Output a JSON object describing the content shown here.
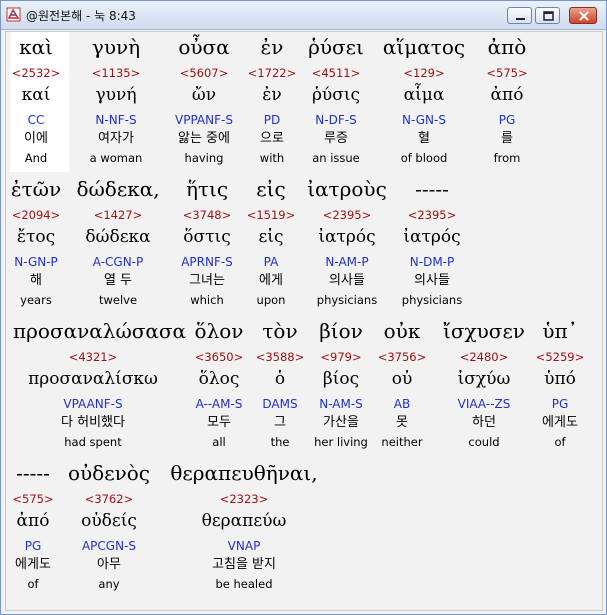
{
  "window": {
    "title": "@원전본해 - 눅 8:43"
  },
  "rows": [
    {
      "words": [
        {
          "greek": "καὶ",
          "strong": "<2532>",
          "lemma": "καί",
          "parse": "CC",
          "korean": "이에",
          "english": "And"
        },
        {
          "greek": "γυνὴ",
          "strong": "<1135>",
          "lemma": "γυνή",
          "parse": "N-NF-S",
          "korean": "여자가",
          "english": "a woman"
        },
        {
          "greek": "οὖσα",
          "strong": "<5607>",
          "lemma": "ὤν",
          "parse": "VPPANF-S",
          "korean": "앓는 중에",
          "english": "having"
        },
        {
          "greek": "ἐν",
          "strong": "<1722>",
          "lemma": "ἐν",
          "parse": "PD",
          "korean": "으로",
          "english": "with"
        },
        {
          "greek": "ῥύσει",
          "strong": "<4511>",
          "lemma": "ῥύσις",
          "parse": "N-DF-S",
          "korean": "루증",
          "english": "an issue"
        },
        {
          "greek": "αἵματος",
          "strong": "<129>",
          "lemma": "αἷμα",
          "parse": "N-GN-S",
          "korean": "혈",
          "english": "of blood"
        },
        {
          "greek": "ἀπὸ",
          "strong": "<575>",
          "lemma": "ἀπό",
          "parse": "PG",
          "korean": "를",
          "english": "from"
        }
      ]
    },
    {
      "words": [
        {
          "greek": "ἐτῶν",
          "strong": "<2094>",
          "lemma": "ἔτος",
          "parse": "N-GN-P",
          "korean": "해",
          "english": "years"
        },
        {
          "greek": "δώδεκα,",
          "strong": "<1427>",
          "lemma": "δώδεκα",
          "parse": "A-CGN-P",
          "korean": "열 두",
          "english": "twelve"
        },
        {
          "greek": "ἥτις",
          "strong": "<3748>",
          "lemma": "ὅστις",
          "parse": "APRNF-S",
          "korean": "그녀는",
          "english": "which"
        },
        {
          "greek": "εἰς",
          "strong": "<1519>",
          "lemma": "εἰς",
          "parse": "PA",
          "korean": "에게",
          "english": "upon"
        },
        {
          "greek": "ἰατροὺς",
          "strong": "<2395>",
          "lemma": "ἰατρός",
          "parse": "N-AM-P",
          "korean": "의사들",
          "english": "physicians"
        },
        {
          "greek": "-----",
          "strong": "<2395>",
          "lemma": "ἰατρός",
          "parse": "N-DM-P",
          "korean": "의사들",
          "english": "physicians"
        }
      ]
    },
    {
      "words": [
        {
          "greek": "προσαναλώσασα",
          "strong": "<4321>",
          "lemma": "προσαναλίσκω",
          "parse": "VPAANF-S",
          "korean": "다 허비했다",
          "english": "had spent"
        },
        {
          "greek": "ὅλον",
          "strong": "<3650>",
          "lemma": "ὅλος",
          "parse": "A--AM-S",
          "korean": "모두",
          "english": "all"
        },
        {
          "greek": "τὸν",
          "strong": "<3588>",
          "lemma": "ὁ",
          "parse": "DAMS",
          "korean": "그",
          "english": "the"
        },
        {
          "greek": "βίον",
          "strong": "<979>",
          "lemma": "βίος",
          "parse": "N-AM-S",
          "korean": "가산을",
          "english": "her living"
        },
        {
          "greek": "οὐκ",
          "strong": "<3756>",
          "lemma": "οὐ",
          "parse": "AB",
          "korean": "못",
          "english": "neither"
        },
        {
          "greek": "ἴσχυσεν",
          "strong": "<2480>",
          "lemma": "ἰσχύω",
          "parse": "VIAA--ZS",
          "korean": "하던",
          "english": "could"
        },
        {
          "greek": "ὑπ᾽",
          "strong": "<5259>",
          "lemma": "ὑπό",
          "parse": "PG",
          "korean": "에게도",
          "english": "of"
        }
      ]
    },
    {
      "words": [
        {
          "greek": "-----",
          "strong": "<575>",
          "lemma": "ἀπό",
          "parse": "PG",
          "korean": "에게도",
          "english": "of"
        },
        {
          "greek": "οὐδενὸς",
          "strong": "<3762>",
          "lemma": "οὐδείς",
          "parse": "APCGN-S",
          "korean": "아무",
          "english": "any"
        },
        {
          "greek": "θεραπευθῆναι,",
          "strong": "<2323>",
          "lemma": "θεραπεύω",
          "parse": "VNAP",
          "korean": "고침을 받지",
          "english": "be healed"
        }
      ]
    }
  ]
}
